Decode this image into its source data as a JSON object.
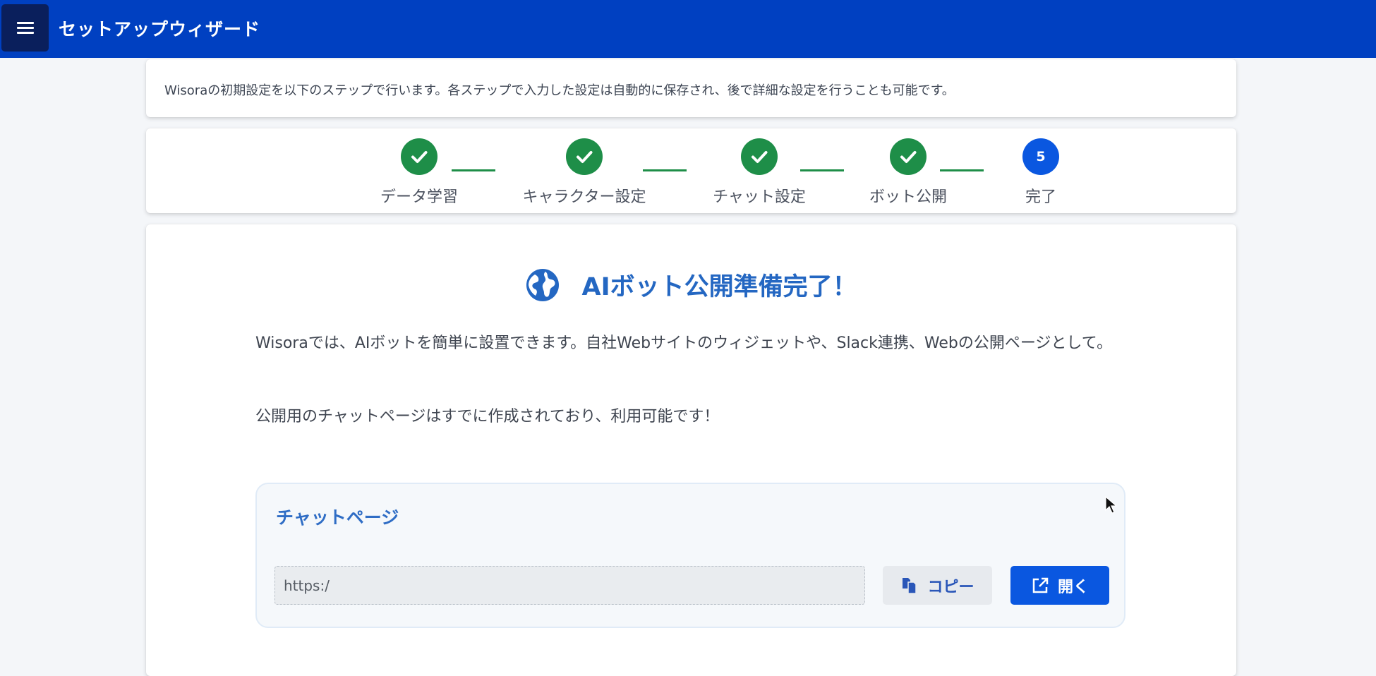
{
  "header": {
    "title": "セットアップウィザード",
    "menu_icon": "hamburger-menu-icon",
    "background": "#0040c1"
  },
  "intro": {
    "text": "Wisoraの初期設定を以下のステップで行います。各ステップで入力した設定は自動的に保存され、後で詳細な設定を行うことも可能です。"
  },
  "steps": [
    {
      "label": "データ学習",
      "status": "done",
      "icon": "check-icon"
    },
    {
      "label": "キャラクター設定",
      "status": "done",
      "icon": "check-icon"
    },
    {
      "label": "チャット設定",
      "status": "done",
      "icon": "check-icon"
    },
    {
      "label": "ボット公開",
      "status": "done",
      "icon": "check-icon"
    },
    {
      "label": "完了",
      "status": "current",
      "number": "5"
    }
  ],
  "main": {
    "heading": "AIボット公開準備完了！",
    "heading_icon": "globe-icon",
    "paragraph1": "Wisoraでは、AIボットを簡単に設置できます。自社Webサイトのウィジェットや、Slack連携、Webの公開ページとして。",
    "paragraph2": "公開用のチャットページはすでに作成されており、利用可能です！",
    "chat_page": {
      "title": "チャットページ",
      "url_value": "https:/",
      "copy_label": "コピー",
      "copy_icon": "copy-icon",
      "open_label": "開く",
      "open_icon": "external-link-icon"
    }
  },
  "colors": {
    "accent": "#0a57e0",
    "success": "#1e8e48",
    "heading": "#2467c2"
  }
}
